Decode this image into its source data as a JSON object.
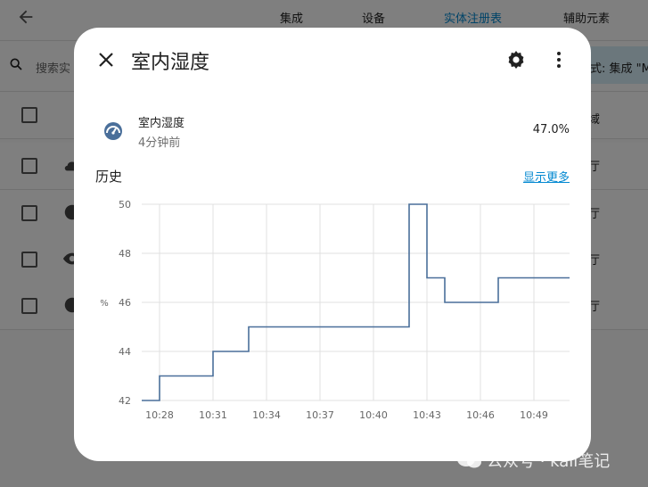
{
  "topbar": {
    "tabs": [
      {
        "label": "集成"
      },
      {
        "label": "设备"
      },
      {
        "label": "实体注册表"
      },
      {
        "label": "辅助元素"
      }
    ]
  },
  "search": {
    "placeholder": "搜索实",
    "filter_chip": "式: 集成 \"M"
  },
  "table": {
    "area_header": "域",
    "rows": [
      {
        "icon": "weather-icon",
        "area": "厅"
      },
      {
        "icon": "gauge-icon",
        "area": "厅"
      },
      {
        "icon": "eye-icon",
        "area": "厅"
      },
      {
        "icon": "gauge-icon",
        "area": "厅"
      }
    ]
  },
  "dialog": {
    "title": "室内湿度",
    "entity": {
      "name": "室内湿度",
      "last_changed": "4分钟前",
      "state": "47.0%"
    },
    "history_heading": "历史",
    "show_more": "显示更多"
  },
  "chart_data": {
    "type": "line",
    "step": true,
    "ylabel": "%",
    "ylim": [
      42,
      50
    ],
    "yticks": [
      "42",
      "44",
      "46",
      "48",
      "50"
    ],
    "xticks": [
      "10:28",
      "10:31",
      "10:34",
      "10:37",
      "10:40",
      "10:43",
      "10:46",
      "10:49"
    ],
    "grid": true,
    "color": "#4a6f9a",
    "series": [
      {
        "x": [
          "10:27",
          "10:28",
          "10:31",
          "10:33",
          "10:42",
          "10:43",
          "10:44",
          "10:47",
          "10:51"
        ],
        "values": [
          42,
          43,
          44,
          45,
          50,
          47,
          46,
          47,
          47
        ]
      }
    ]
  },
  "watermark": "公众号 · kali笔记"
}
